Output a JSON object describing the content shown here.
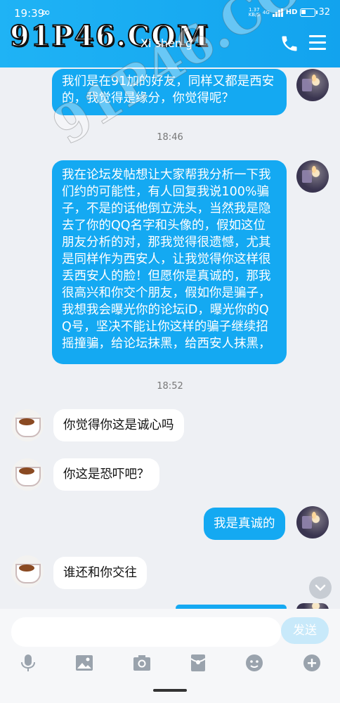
{
  "status_bar": {
    "time": "19:39",
    "infinity": "∞",
    "speed_top": "1.37",
    "speed_bottom": "KB/S",
    "network": "4G",
    "hd": "HD",
    "battery": "32"
  },
  "header": {
    "logo": "91P46.COM",
    "contact_name": "Xi shen g"
  },
  "messages": [
    {
      "id": "m1",
      "side": "sent",
      "text": "我们是在91加的好友，同样又都是西安的，我觉得是缘分，你觉得呢？"
    },
    {
      "id": "t1",
      "type": "time",
      "text": "18:46"
    },
    {
      "id": "m2",
      "side": "sent",
      "text": "我在论坛发帖想让大家帮我分析一下我们约的可能性，有人回复我说100%骗子，不是的话他倒立洗头，当然我是隐去了你的QQ名字和头像的，假如这位朋友分析的对，那我觉得很遗憾，尤其是同样作为西安人，让我觉得你这样很丢西安人的脸！但愿你是真诚的，那我很高兴和你交个朋友，假如你是骗子，我想我会曝光你的论坛iD，曝光你的QQ号，坚决不能让你这样的骗子继续招摇撞骗，给论坛抹黑，给西安人抹黑，"
    },
    {
      "id": "t2",
      "type": "time",
      "text": "18:52"
    },
    {
      "id": "m3",
      "side": "recv",
      "text": "你觉得你这是诚心吗"
    },
    {
      "id": "m4",
      "side": "recv",
      "text": "你这是恐吓吧？"
    },
    {
      "id": "m5",
      "side": "sent",
      "text": "我是真诚的"
    },
    {
      "id": "m6",
      "side": "recv",
      "text": "谁还和你交往"
    }
  ],
  "input": {
    "placeholder": "",
    "send_label": "发送"
  },
  "toolbar": [
    "mic-icon",
    "image-icon",
    "camera-icon",
    "red-packet-icon",
    "emoji-icon",
    "plus-icon"
  ],
  "watermark": "91P46.COM",
  "colors": {
    "header": "#14a9f2",
    "sent_bubble": "#14a9f2",
    "received_bubble": "#ffffff",
    "background": "#eef0f4"
  }
}
